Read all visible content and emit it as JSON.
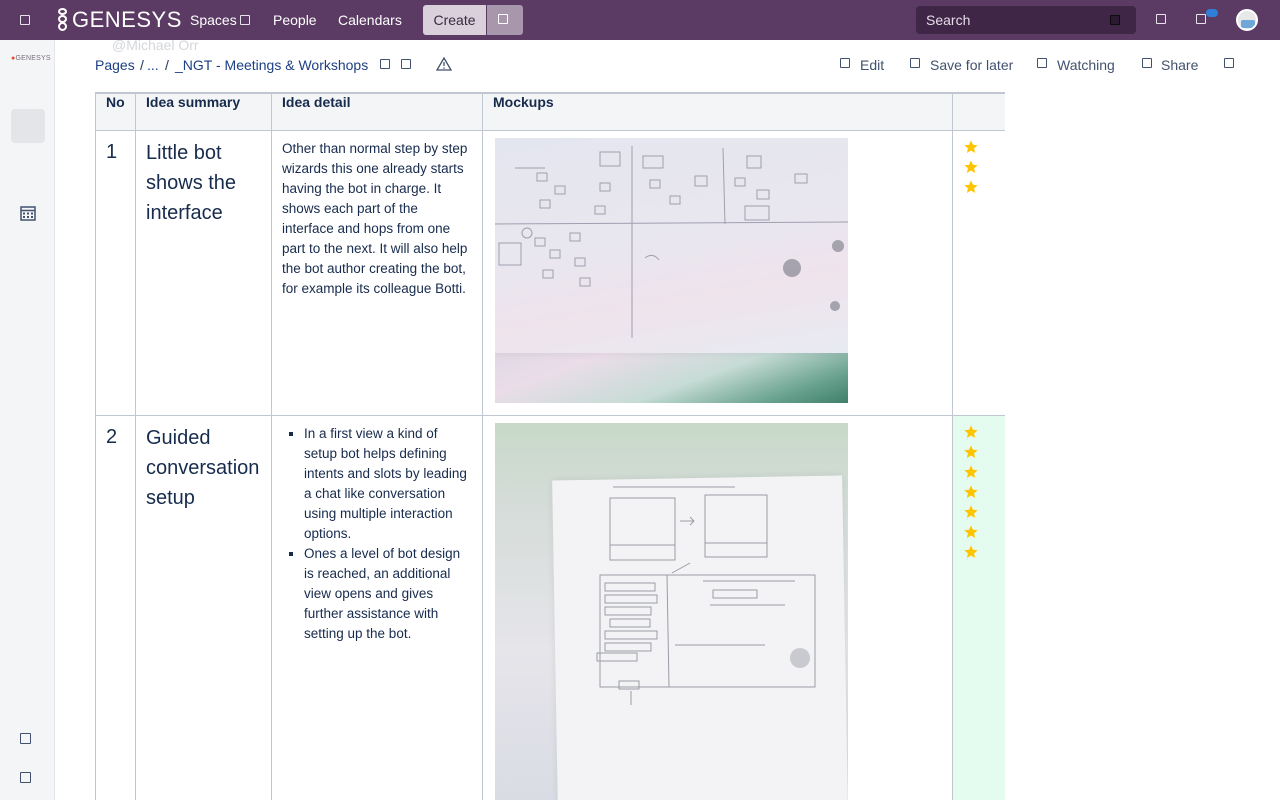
{
  "topbar": {
    "brand": "GENESYS",
    "nav": {
      "spaces": "Spaces",
      "people": "People",
      "calendars": "Calendars"
    },
    "create_label": "Create",
    "search_placeholder": "Search"
  },
  "rail": {
    "logo_text": "GENESYS"
  },
  "breadcrumb": {
    "ghost_text": "@Michael Orr",
    "pages": "Pages",
    "sep1": "/",
    "ellipsis": "...",
    "sep2": "/",
    "current": "_NGT - Meetings & Workshops"
  },
  "actions": {
    "edit": "Edit",
    "save_for_later": "Save for later",
    "watching": "Watching",
    "share": "Share"
  },
  "table": {
    "headers": {
      "no": "No",
      "summary": "Idea summary",
      "detail": "Idea detail",
      "mockups": "Mockups",
      "rating": ""
    },
    "rows": [
      {
        "no": "1",
        "summary": "Little bot shows the interface",
        "detail": "Other than normal step by step wizards this one already starts having the bot in charge. It shows each part of the interface and hops from one part to the next. It will also help the bot author creating the bot, for example its colleague Botti.",
        "stars": 3,
        "highlight": false
      },
      {
        "no": "2",
        "summary": "Guided conversation setup",
        "detail_items": [
          "In a first view a kind of setup bot helps defining intents and slots by leading a chat like conversation using multiple interaction options.",
          "Ones a level of bot design is reached, an additional view opens and gives further assistance with setting up the bot."
        ],
        "stars": 7,
        "highlight": true
      }
    ]
  },
  "colors": {
    "topbar": "#5b3a63",
    "star": "#ffc400",
    "highlight": "#e3fcef",
    "link": "#1d3f84"
  },
  "icons": [
    "menu-icon",
    "genesys-logo-icon",
    "chevron-down-icon",
    "search-icon",
    "help-icon",
    "notifications-icon",
    "calendar-icon",
    "star-icon",
    "warning-icon",
    "edit-icon",
    "bookmark-icon",
    "watch-icon",
    "share-icon",
    "more-icon"
  ]
}
